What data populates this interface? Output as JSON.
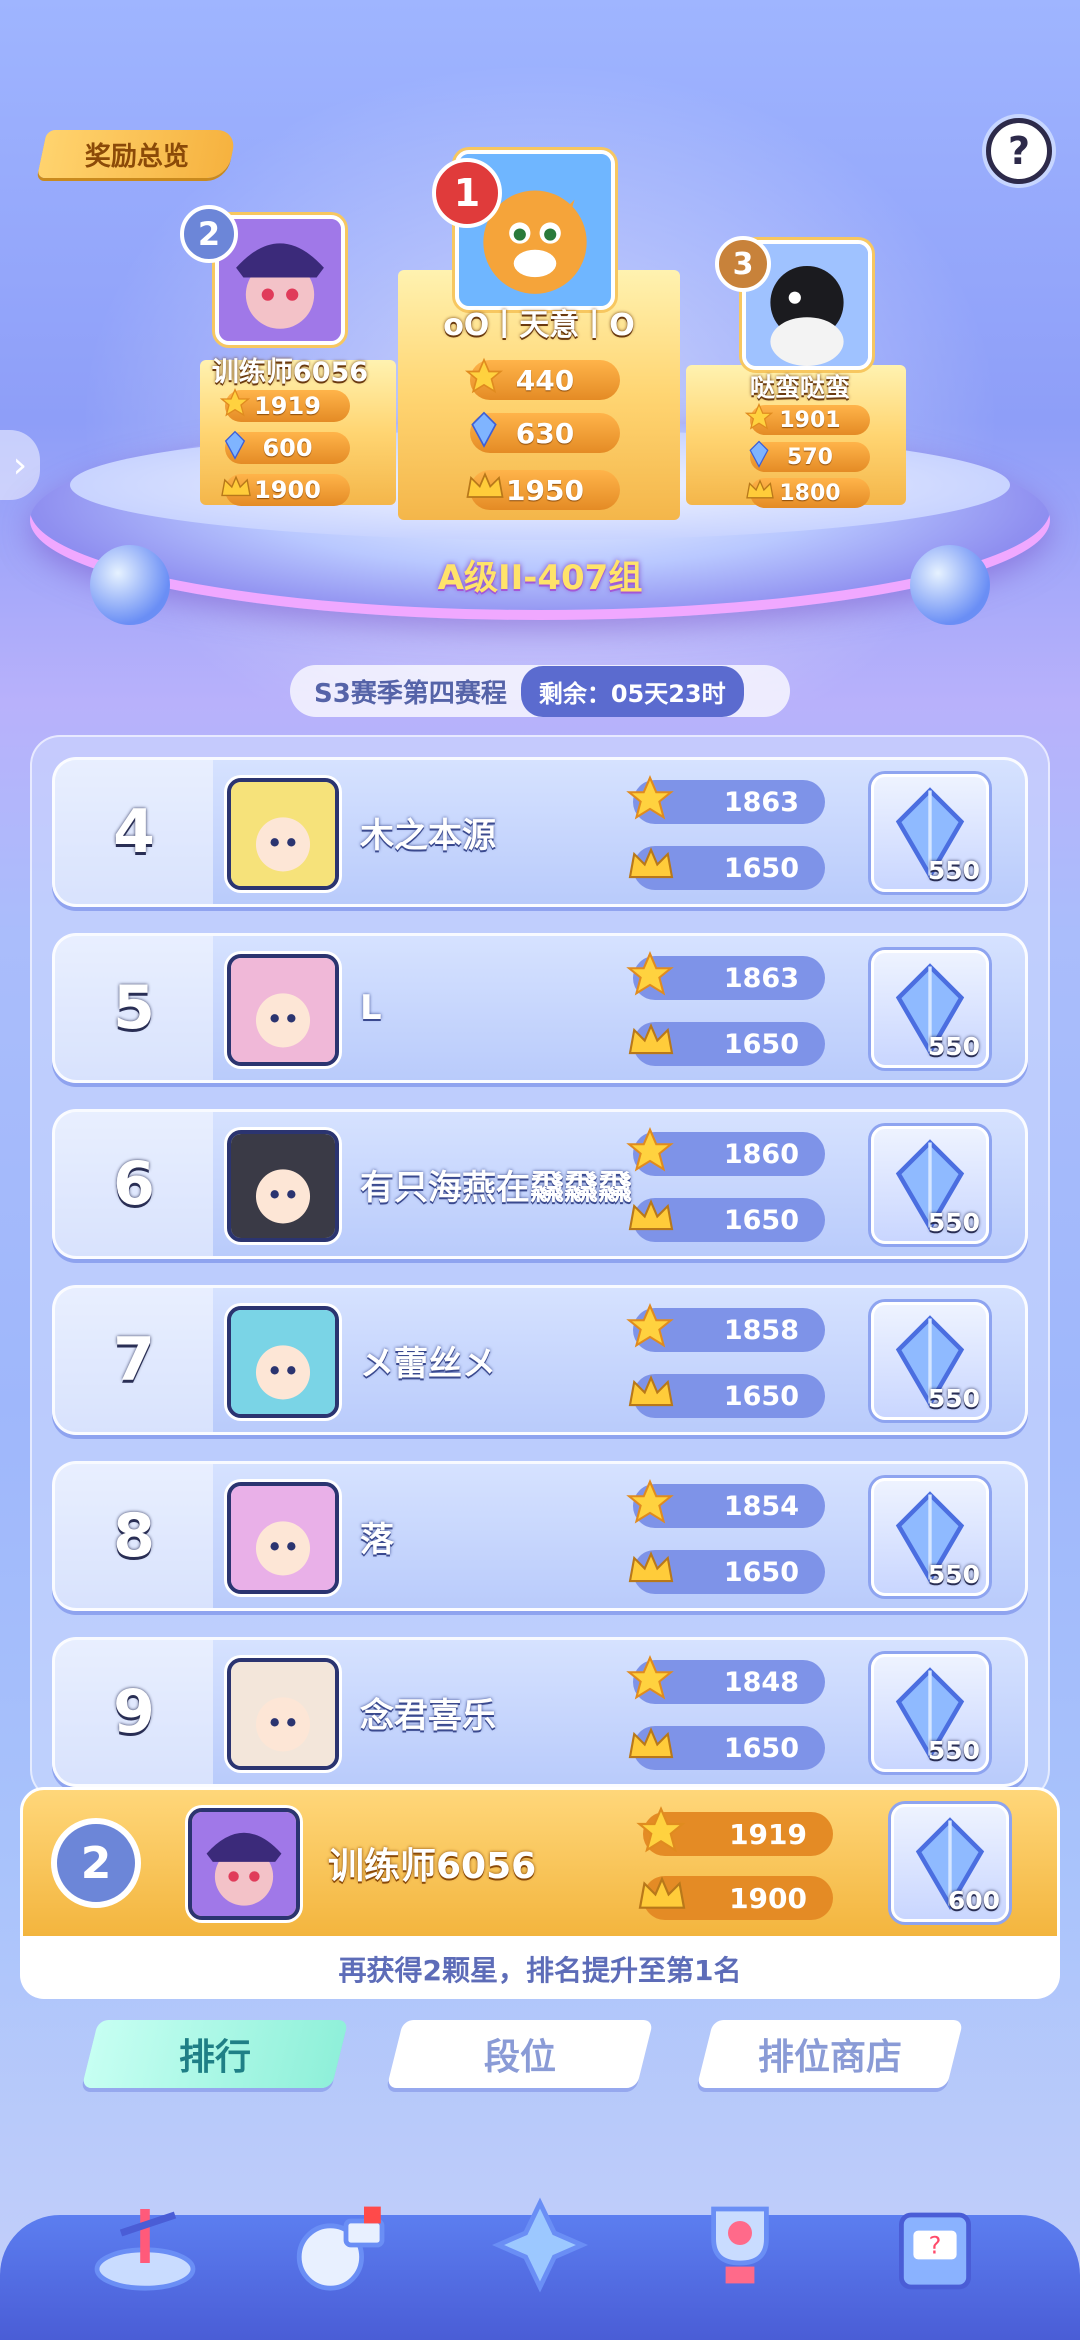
{
  "header": {
    "reward_overview": "奖励总览",
    "help": "?"
  },
  "top3": [
    {
      "rank": "1",
      "name": "oO丨天意丨O",
      "stars": "440",
      "crystals": "630",
      "crowns": "1950"
    },
    {
      "rank": "2",
      "name": "训练师6056",
      "stars": "1919",
      "crystals": "600",
      "crowns": "1900"
    },
    {
      "rank": "3",
      "name": "哒蛮哒蛮",
      "stars": "1901",
      "crystals": "570",
      "crowns": "1800"
    }
  ],
  "group_label": "A级II-407组",
  "season": {
    "title": "S3赛季第四赛程",
    "remaining": "剩余：05天23时"
  },
  "rows": [
    {
      "rank": "4",
      "name": "木之本源",
      "stars": "1863",
      "crowns": "1650",
      "reward": "550"
    },
    {
      "rank": "5",
      "name": "L",
      "stars": "1863",
      "crowns": "1650",
      "reward": "550"
    },
    {
      "rank": "6",
      "name": "有只海燕在飝飝飝",
      "stars": "1860",
      "crowns": "1650",
      "reward": "550"
    },
    {
      "rank": "7",
      "name": "メ蕾丝メ",
      "stars": "1858",
      "crowns": "1650",
      "reward": "550"
    },
    {
      "rank": "8",
      "name": "落",
      "stars": "1854",
      "crowns": "1650",
      "reward": "550"
    },
    {
      "rank": "9",
      "name": "念君喜乐",
      "stars": "1848",
      "crowns": "1650",
      "reward": "550"
    }
  ],
  "self": {
    "rank": "2",
    "name": "训练师6056",
    "stars": "1919",
    "crowns": "1900",
    "reward": "600",
    "tip": "再获得2颗星，排名提升至第1名"
  },
  "tabs": [
    "排行",
    "段位",
    "排位商店"
  ],
  "nav_icons": [
    "arena-icon",
    "whistle-icon",
    "gamepad-icon",
    "trophy-icon",
    "slot-machine-icon"
  ],
  "colors": {
    "accent_gold": "#f4b64a",
    "accent_blue": "#5b6bcf",
    "active_tab": "#8ff0d9"
  }
}
